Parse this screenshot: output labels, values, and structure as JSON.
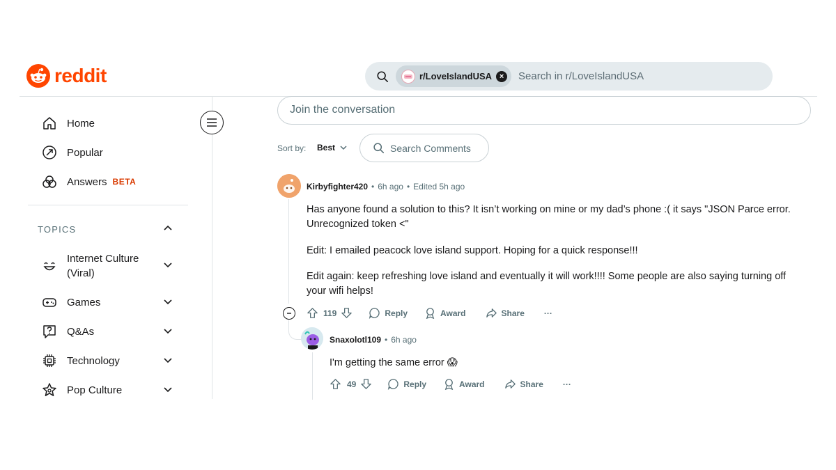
{
  "header": {
    "logo_text": "reddit",
    "brand_color": "#ff4500",
    "search": {
      "chip_label": "r/LoveIslandUSA",
      "chip_close_icon": "close-icon",
      "placeholder": "Search in r/LoveIslandUSA"
    }
  },
  "sidebar": {
    "items": [
      {
        "label": "Home",
        "icon": "home-icon"
      },
      {
        "label": "Popular",
        "icon": "popular-icon"
      },
      {
        "label": "Answers",
        "badge": "BETA",
        "icon": "answers-icon"
      }
    ],
    "topics_heading": "TOPICS",
    "topics": [
      {
        "label": "Internet Culture (Viral)",
        "icon": "smile-icon"
      },
      {
        "label": "Games",
        "icon": "gamepad-icon"
      },
      {
        "label": "Q&As",
        "icon": "question-icon"
      },
      {
        "label": "Technology",
        "icon": "chip-icon"
      },
      {
        "label": "Pop Culture",
        "icon": "star-icon"
      }
    ]
  },
  "main": {
    "join_placeholder": "Join the conversation",
    "sort_label": "Sort by:",
    "sort_value": "Best",
    "search_comments": "Search Comments",
    "comments": [
      {
        "user": "Kirbyfighter420",
        "time": "6h ago",
        "edited": "Edited 5h ago",
        "paragraphs": [
          "Has anyone found a solution to this? It isn’t working on mine or my dad’s phone :( it says \"JSON Parce error. Unrecognized token <\"",
          "Edit: I emailed peacock love island support. Hoping for a quick response!!!",
          "Edit again: keep refreshing love island and eventually it will work!!!! Some people are also saying turning off your wifi helps!"
        ],
        "votes": "119",
        "reply": "Reply",
        "award": "Award",
        "share": "Share",
        "more": "···"
      },
      {
        "user": "Snaxolotl109",
        "time": "6h ago",
        "text": "I'm getting the same error 😱",
        "votes": "49",
        "reply": "Reply",
        "award": "Award",
        "share": "Share",
        "more": "···"
      }
    ]
  }
}
